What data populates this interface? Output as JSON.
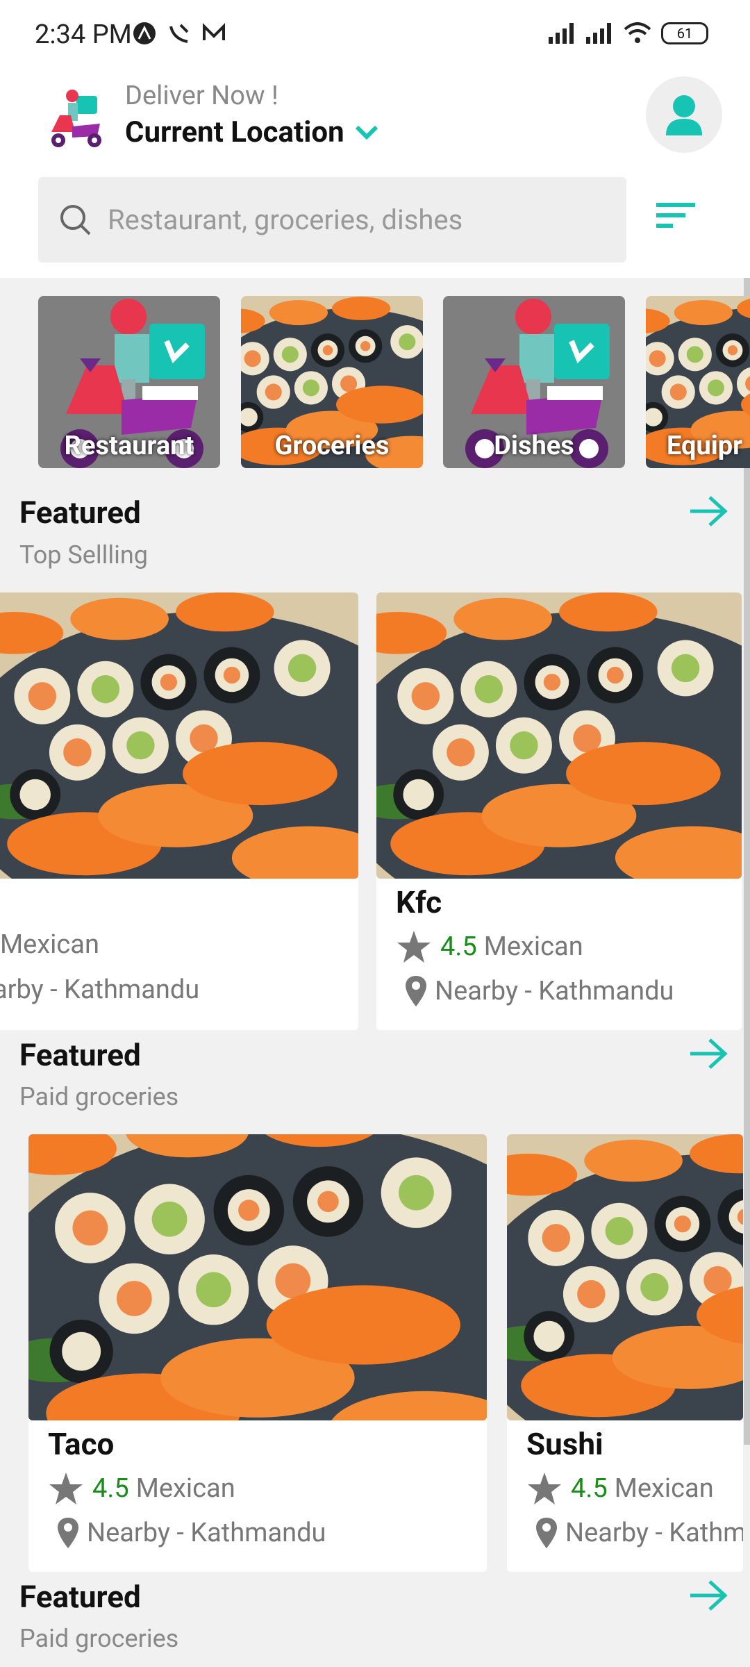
{
  "status_bar": {
    "time": "2:34 PM",
    "battery": "61"
  },
  "header": {
    "deliver_label": "Deliver Now !",
    "location_label": "Current Location"
  },
  "search": {
    "placeholder": "Restaurant, groceries, dishes"
  },
  "categories": [
    {
      "label": "Restaurant",
      "image": "delivery-scooter"
    },
    {
      "label": "Groceries",
      "image": "sushi"
    },
    {
      "label": "Dishes",
      "image": "delivery-scooter"
    },
    {
      "label": "Equipr",
      "image": "sushi"
    }
  ],
  "sections": [
    {
      "title": "Featured",
      "subtitle": "Top Sellling",
      "cards": [
        {
          "name": "",
          "rating": "",
          "cuisine": "Mexican",
          "location": "arby - Kathmandu"
        },
        {
          "name": "Kfc",
          "rating": "4.5",
          "cuisine": "Mexican",
          "location": "Nearby - Kathmandu"
        }
      ]
    },
    {
      "title": "Featured",
      "subtitle": "Paid groceries",
      "cards": [
        {
          "name": "Taco",
          "rating": "4.5",
          "cuisine": "Mexican",
          "location": "Nearby - Kathmandu"
        },
        {
          "name": "Sushi",
          "rating": "4.5",
          "cuisine": "Mexican",
          "location": "Nearby - Kathm"
        }
      ]
    },
    {
      "title": "Featured",
      "subtitle": "Paid groceries"
    }
  ],
  "colors": {
    "accent": "#17c3b2",
    "rating": "#1a8c1a",
    "muted": "#888888"
  }
}
